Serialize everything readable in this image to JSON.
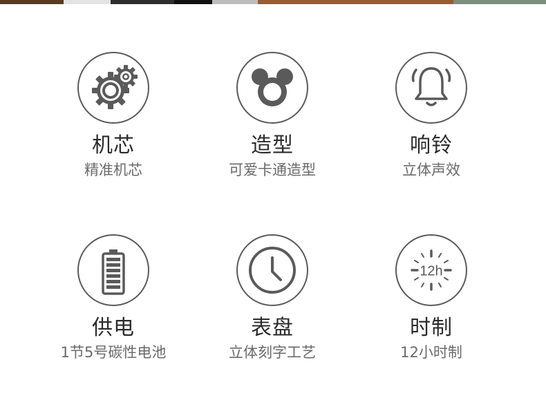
{
  "top_strip_colors": [
    "#5b3a1f",
    "#e3e3e3",
    "#2e2e2e",
    "#111111",
    "#bdbdbd",
    "#9a5c2e",
    "#7b8f7c"
  ],
  "features": [
    {
      "icon": "gears-icon",
      "title": "机芯",
      "subtitle": "精准机芯"
    },
    {
      "icon": "mouse-ears-icon",
      "title": "造型",
      "subtitle": "可爱卡通造型"
    },
    {
      "icon": "bell-icon",
      "title": "响铃",
      "subtitle": "立体声效"
    },
    {
      "icon": "battery-icon",
      "title": "供电",
      "subtitle": "1节5号碳性电池"
    },
    {
      "icon": "clock-icon",
      "title": "表盘",
      "subtitle": "立体刻字工艺"
    },
    {
      "icon": "twelve-hour-icon",
      "title": "时制",
      "subtitle": "12小时制",
      "icon_text": "12h"
    }
  ]
}
